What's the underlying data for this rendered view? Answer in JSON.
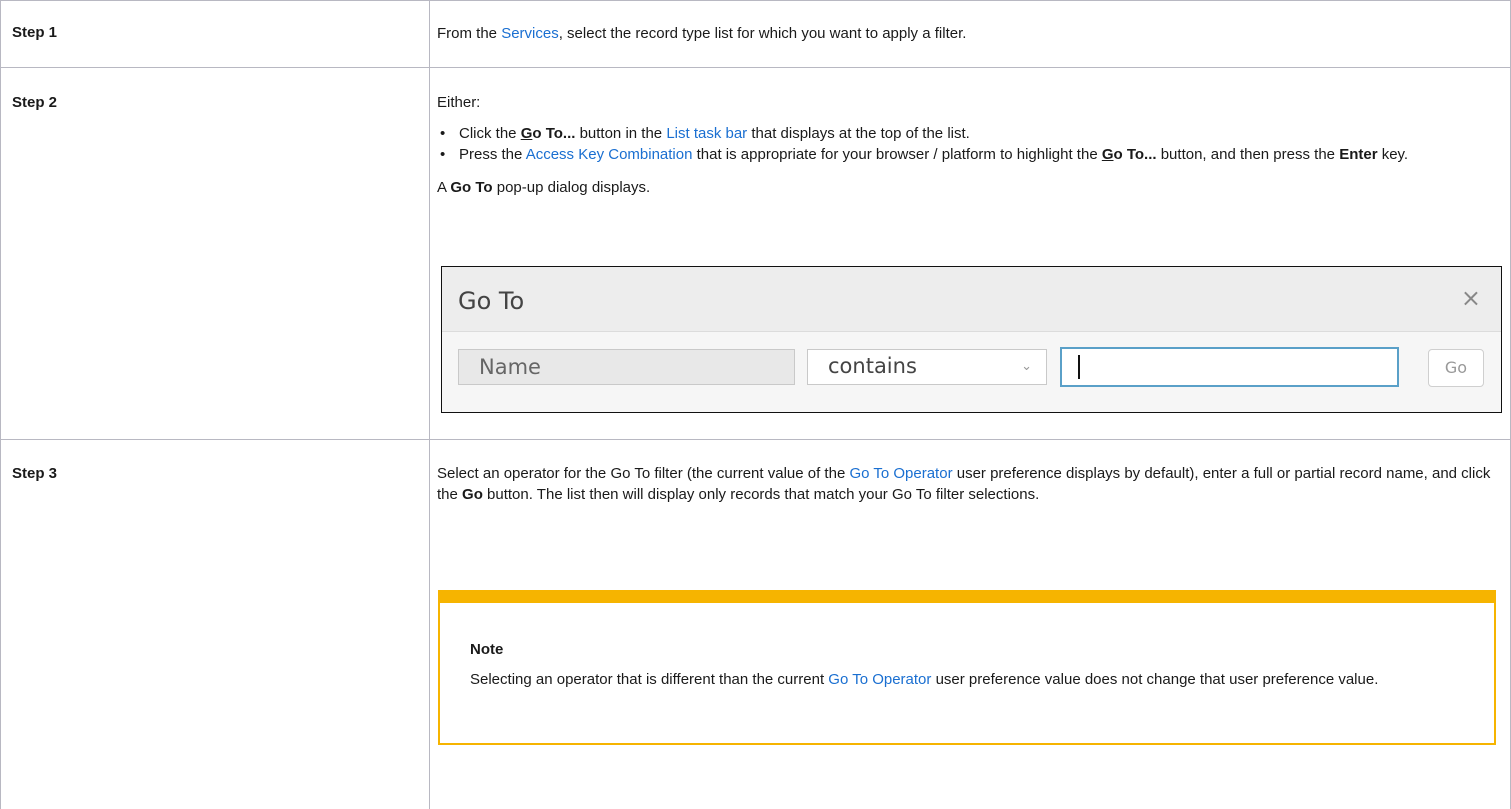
{
  "steps": [
    {
      "label": "Step 1",
      "text_before": "From the ",
      "link": "Services",
      "text_after": ", select the record type list for which you want to apply a filter."
    },
    {
      "label": "Step 2",
      "intro": "Either:",
      "bullet1": {
        "pre": "Click the ",
        "bold_underlined": "G",
        "bold_rest": "o To...",
        "mid": " button in the ",
        "link": "List task bar",
        "post": " that displays at the top of the list."
      },
      "bullet2": {
        "pre": "Press the ",
        "link": "Access Key Combination",
        "mid": " that is appropriate for your browser / platform to highlight the ",
        "bold_underlined": "G",
        "bold_rest": "o To...",
        "mid2": " button, and then press the ",
        "bold_key": "Enter",
        "post": " key."
      },
      "after_pre": "A ",
      "after_bold": "Go To",
      "after_post": " pop-up dialog displays."
    },
    {
      "label": "Step 3",
      "p1": "Select an operator for the Go To filter (the current value of the ",
      "link": "Go To Operator",
      "p2": " user preference displays by default), enter a full or partial record name, and click the ",
      "bold": "Go",
      "p3": " button. The list then will display only records that match your Go To filter selections."
    }
  ],
  "dialog": {
    "title": "Go To",
    "close_glyph": "×",
    "field_value": "Name",
    "operator_value": "contains",
    "chevron_glyph": "⌄",
    "go_label": "Go"
  },
  "note": {
    "title": "Note",
    "pre": "Selecting an operator that is different than the current ",
    "link": "Go To Operator",
    "post": " user preference value does not change that user preference value."
  },
  "bullet_glyph": "•",
  "colors": {
    "link": "#1a6fd1",
    "note_border": "#f6b400",
    "focus_border": "#5aa0c8"
  }
}
